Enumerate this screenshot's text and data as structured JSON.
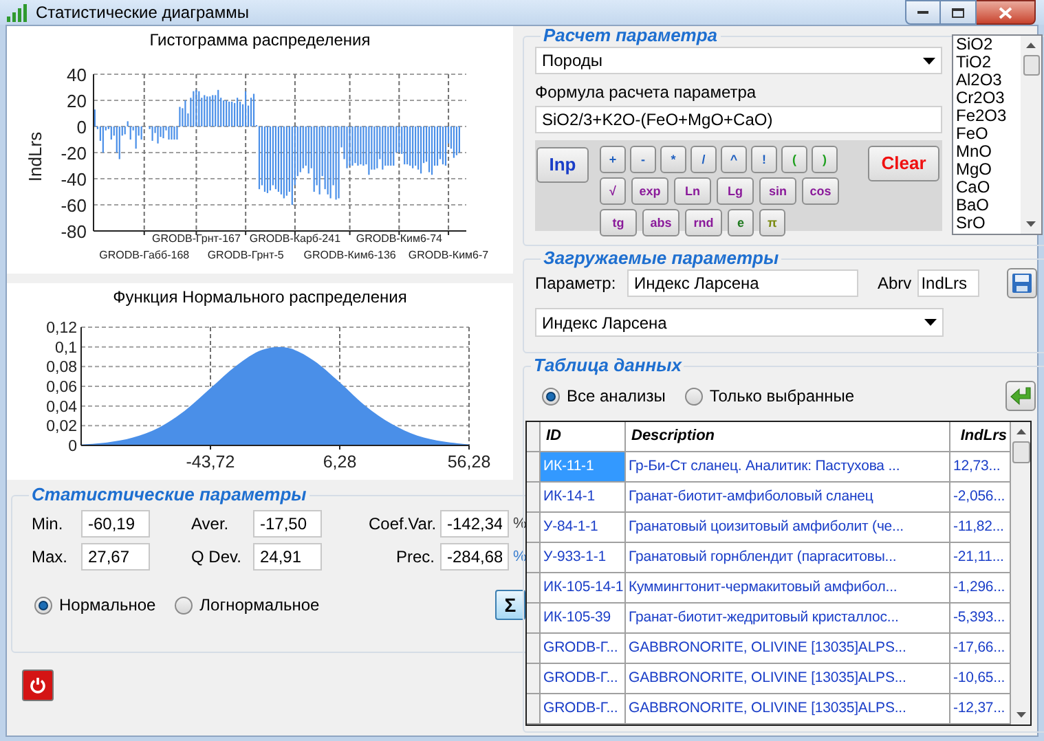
{
  "window": {
    "title": "Статистические диаграммы"
  },
  "histogram": {
    "chart_data": {
      "type": "bar",
      "title": "Гистограмма распределения",
      "grid": true,
      "ylim": [
        -80,
        40
      ],
      "yticks": [
        40,
        20,
        0,
        -20,
        -40,
        -60,
        -80
      ],
      "categories": [
        null,
        null,
        null,
        null,
        null,
        null,
        null,
        null,
        null,
        null,
        null,
        null,
        null,
        null,
        null,
        null,
        null,
        null,
        "GRODB-Габб-168",
        null,
        null,
        null,
        null,
        null,
        null,
        null,
        null,
        null,
        null,
        null,
        null,
        null,
        null,
        null,
        null,
        null,
        null,
        "GRODB-Грнт-167",
        null,
        null,
        null,
        null,
        null,
        null,
        null,
        null,
        null,
        null,
        null,
        null,
        null,
        null,
        null,
        null,
        null,
        "GRODB-Грнт-5",
        null,
        null,
        null,
        null,
        null,
        null,
        null,
        null,
        null,
        null,
        null,
        null,
        null,
        null,
        null,
        null,
        null,
        "GRODB-Карб-241",
        null,
        null,
        null,
        null,
        null,
        null,
        null,
        null,
        null,
        null,
        null,
        null,
        null,
        null,
        null,
        null,
        null,
        null,
        null,
        "GRODB-Ким6-136",
        null,
        null,
        null,
        null,
        null,
        null,
        null,
        null,
        null,
        null,
        null,
        null,
        null,
        null,
        null,
        null,
        null,
        "GRODB-Ким6-74",
        null,
        null,
        null,
        null,
        null,
        null,
        null,
        null,
        null,
        null,
        null,
        null,
        null,
        null,
        null,
        null,
        null,
        "GRODB-Ким6-7",
        null,
        null,
        null,
        null
      ],
      "series": [
        {
          "name": "IndLrs",
          "color": "#4a8fe8",
          "values": [
            13,
            -2,
            -11,
            -20,
            -3,
            -2,
            -10,
            -7,
            -20,
            -25,
            -7,
            -6,
            4,
            -10,
            -3,
            -17,
            -7,
            -10,
            null,
            null,
            -2,
            -11,
            -5,
            -13,
            -8,
            -9,
            -3,
            -10,
            -10,
            -10,
            -10,
            15,
            14,
            20,
            10,
            22,
            27,
            28,
            27,
            22,
            24,
            23,
            23,
            24,
            24,
            28,
            22,
            20,
            20,
            19,
            19,
            18,
            22,
            19,
            17,
            27,
            16,
            22,
            25,
            1,
            -48,
            -45,
            -50,
            -51,
            -49,
            -45,
            -48,
            -50,
            -52,
            -55,
            -53,
            -50,
            -60,
            -45,
            -38,
            -35,
            -32,
            -30,
            -36,
            -32,
            -50,
            -45,
            -52,
            -38,
            -48,
            -52,
            -55,
            -45,
            -56,
            -55,
            -16,
            -25,
            -32,
            -30,
            -30,
            -28,
            -30,
            -29,
            -30,
            -29,
            -37,
            -33,
            -33,
            -32,
            -25,
            -33,
            -30,
            -30,
            -30,
            -30,
            -20,
            -20,
            -21,
            -29,
            -29,
            -30,
            -32,
            -30,
            -33,
            -36,
            -28,
            -27,
            -35,
            -37,
            -30,
            -30,
            -25,
            -29,
            -30,
            -13,
            -17,
            -24,
            -22,
            -20
          ]
        }
      ]
    }
  },
  "normal": {
    "chart_data": {
      "type": "area",
      "title": "Функция Нормального распределения",
      "grid": true,
      "xlim": [
        -93.72,
        56.28
      ],
      "ylim": [
        0,
        0.12
      ],
      "x": [
        -93.72,
        -83.72,
        -73.72,
        -63.72,
        -53.72,
        -43.72,
        -33.72,
        -23.72,
        -13.72,
        -3.72,
        6.28,
        16.28,
        26.28,
        36.28,
        46.28,
        56.28
      ],
      "xticks": [
        {
          "value": -43.72,
          "label": "-43,72"
        },
        {
          "value": 6.28,
          "label": "6,28"
        },
        {
          "value": 56.28,
          "label": "56,28"
        }
      ],
      "yticks": [
        {
          "value": 0.12,
          "label": "0,12"
        },
        {
          "value": 0.1,
          "label": "0,1"
        },
        {
          "value": 0.08,
          "label": "0,08"
        },
        {
          "value": 0.06,
          "label": "0,06"
        },
        {
          "value": 0.04,
          "label": "0,04"
        },
        {
          "value": 0.02,
          "label": "0,02"
        },
        {
          "value": 0,
          "label": "0"
        }
      ],
      "series": [
        {
          "color": "#4a8fe8",
          "values": [
            0.001,
            0.003,
            0.008,
            0.018,
            0.035,
            0.058,
            0.081,
            0.097,
            0.099,
            0.086,
            0.064,
            0.04,
            0.022,
            0.01,
            0.004,
            0.001
          ]
        }
      ]
    }
  },
  "stats": {
    "title": "Статистические параметры",
    "fields": [
      {
        "label": "Min.",
        "value": "-60,19"
      },
      {
        "label": "Aver.",
        "value": "-17,50"
      },
      {
        "label": "Coef.Var.",
        "value": "-142,34",
        "unit": "%",
        "color": "#404040"
      },
      {
        "label": "Max.",
        "value": "27,67"
      },
      {
        "label": "Q Dev.",
        "value": "24,91"
      },
      {
        "label": "Prec.",
        "value": "-284,68",
        "unit": "%",
        "color": "#3a7fd0"
      }
    ],
    "distribution": [
      {
        "label": "Нормальное",
        "selected": true
      },
      {
        "label": "Логнормальное",
        "selected": false
      }
    ],
    "sum_button": "Σ"
  },
  "calc": {
    "title": "Расчет параметра",
    "source": "Породы",
    "formula_label": "Формула расчета параметра",
    "formula": "SiO2/3+K2O-(FeO+MgO+CaO)",
    "input_button": "Inp",
    "clear_button": "Clear",
    "keys": [
      [
        {
          "label": "+",
          "color": "#2060c0"
        },
        {
          "label": "-",
          "color": "#2060c0"
        },
        {
          "label": "*",
          "color": "#2060c0"
        },
        {
          "label": "/",
          "color": "#2060c0"
        },
        {
          "label": "^",
          "color": "#2060c0"
        },
        {
          "label": "!",
          "color": "#2060c0"
        },
        {
          "label": "(",
          "color": "#20a020"
        },
        {
          "label": ")",
          "color": "#20a020"
        }
      ],
      [
        {
          "label": "√",
          "color": "#8a1a9a"
        },
        {
          "label": "exp",
          "color": "#8a1a9a"
        },
        {
          "label": "Ln",
          "color": "#8a1a9a"
        },
        {
          "label": "Lg",
          "color": "#8a1a9a"
        },
        {
          "label": "sin",
          "color": "#8a1a9a"
        },
        {
          "label": "cos",
          "color": "#8a1a9a"
        }
      ],
      [
        {
          "label": "tg",
          "color": "#8a1a9a"
        },
        {
          "label": "abs",
          "color": "#8a1a9a"
        },
        {
          "label": "rnd",
          "color": "#8a1a9a"
        },
        {
          "label": "e",
          "color": "#207a20"
        },
        {
          "label": "π",
          "color": "#7a8a10"
        }
      ]
    ],
    "components": [
      "SiO2",
      "TiO2",
      "Al2O3",
      "Cr2O3",
      "Fe2O3",
      "FeO",
      "MnO",
      "MgO",
      "CaO",
      "BaO",
      "SrO"
    ]
  },
  "loaded": {
    "title": "Загружаемые параметры",
    "param_label": "Параметр:",
    "param_value": "Индекс Ларсена",
    "abrv_label": "Abrv",
    "abrv_value": "IndLrs",
    "selected_param": "Индекс Ларсена"
  },
  "table": {
    "title": "Таблица данных",
    "filters": [
      {
        "label": "Все анализы",
        "selected": true
      },
      {
        "label": "Только выбранные",
        "selected": false
      }
    ],
    "columns": [
      "ID",
      "Description",
      "IndLrs"
    ],
    "rows": [
      {
        "selected": true,
        "cells": [
          "ИК-11-1",
          "Гр-Би-Ст сланец. Аналитик: Пастухова ...",
          "12,73..."
        ]
      },
      {
        "selected": false,
        "cells": [
          "ИК-14-1",
          "Гранат-биотит-амфиболовый сланец",
          "-2,056..."
        ]
      },
      {
        "selected": false,
        "cells": [
          "У-84-1-1",
          "Гранатовый цоизитовый амфиболит (че...",
          "-11,82..."
        ]
      },
      {
        "selected": false,
        "cells": [
          "У-933-1-1",
          "Гранатовый горнблендит (паргаситовы...",
          "-21,11..."
        ]
      },
      {
        "selected": false,
        "cells": [
          "ИК-105-14-1",
          "Куммингтонит-чермакитовый амфибол...",
          "-1,296..."
        ]
      },
      {
        "selected": false,
        "cells": [
          "ИК-105-39",
          "Гранат-биотит-жедритовый кристаллос...",
          "-5,393..."
        ]
      },
      {
        "selected": false,
        "cells": [
          "GRODB-Г...",
          "GABBRONORITE, OLIVINE [13035]ALPS...",
          "-17,66..."
        ]
      },
      {
        "selected": false,
        "cells": [
          "GRODB-Г...",
          "GABBRONORITE, OLIVINE [13035]ALPS...",
          "-10,65..."
        ]
      },
      {
        "selected": false,
        "cells": [
          "GRODB-Г...",
          "GABBRONORITE, OLIVINE [13035]ALPS...",
          "-12,37..."
        ]
      }
    ]
  }
}
